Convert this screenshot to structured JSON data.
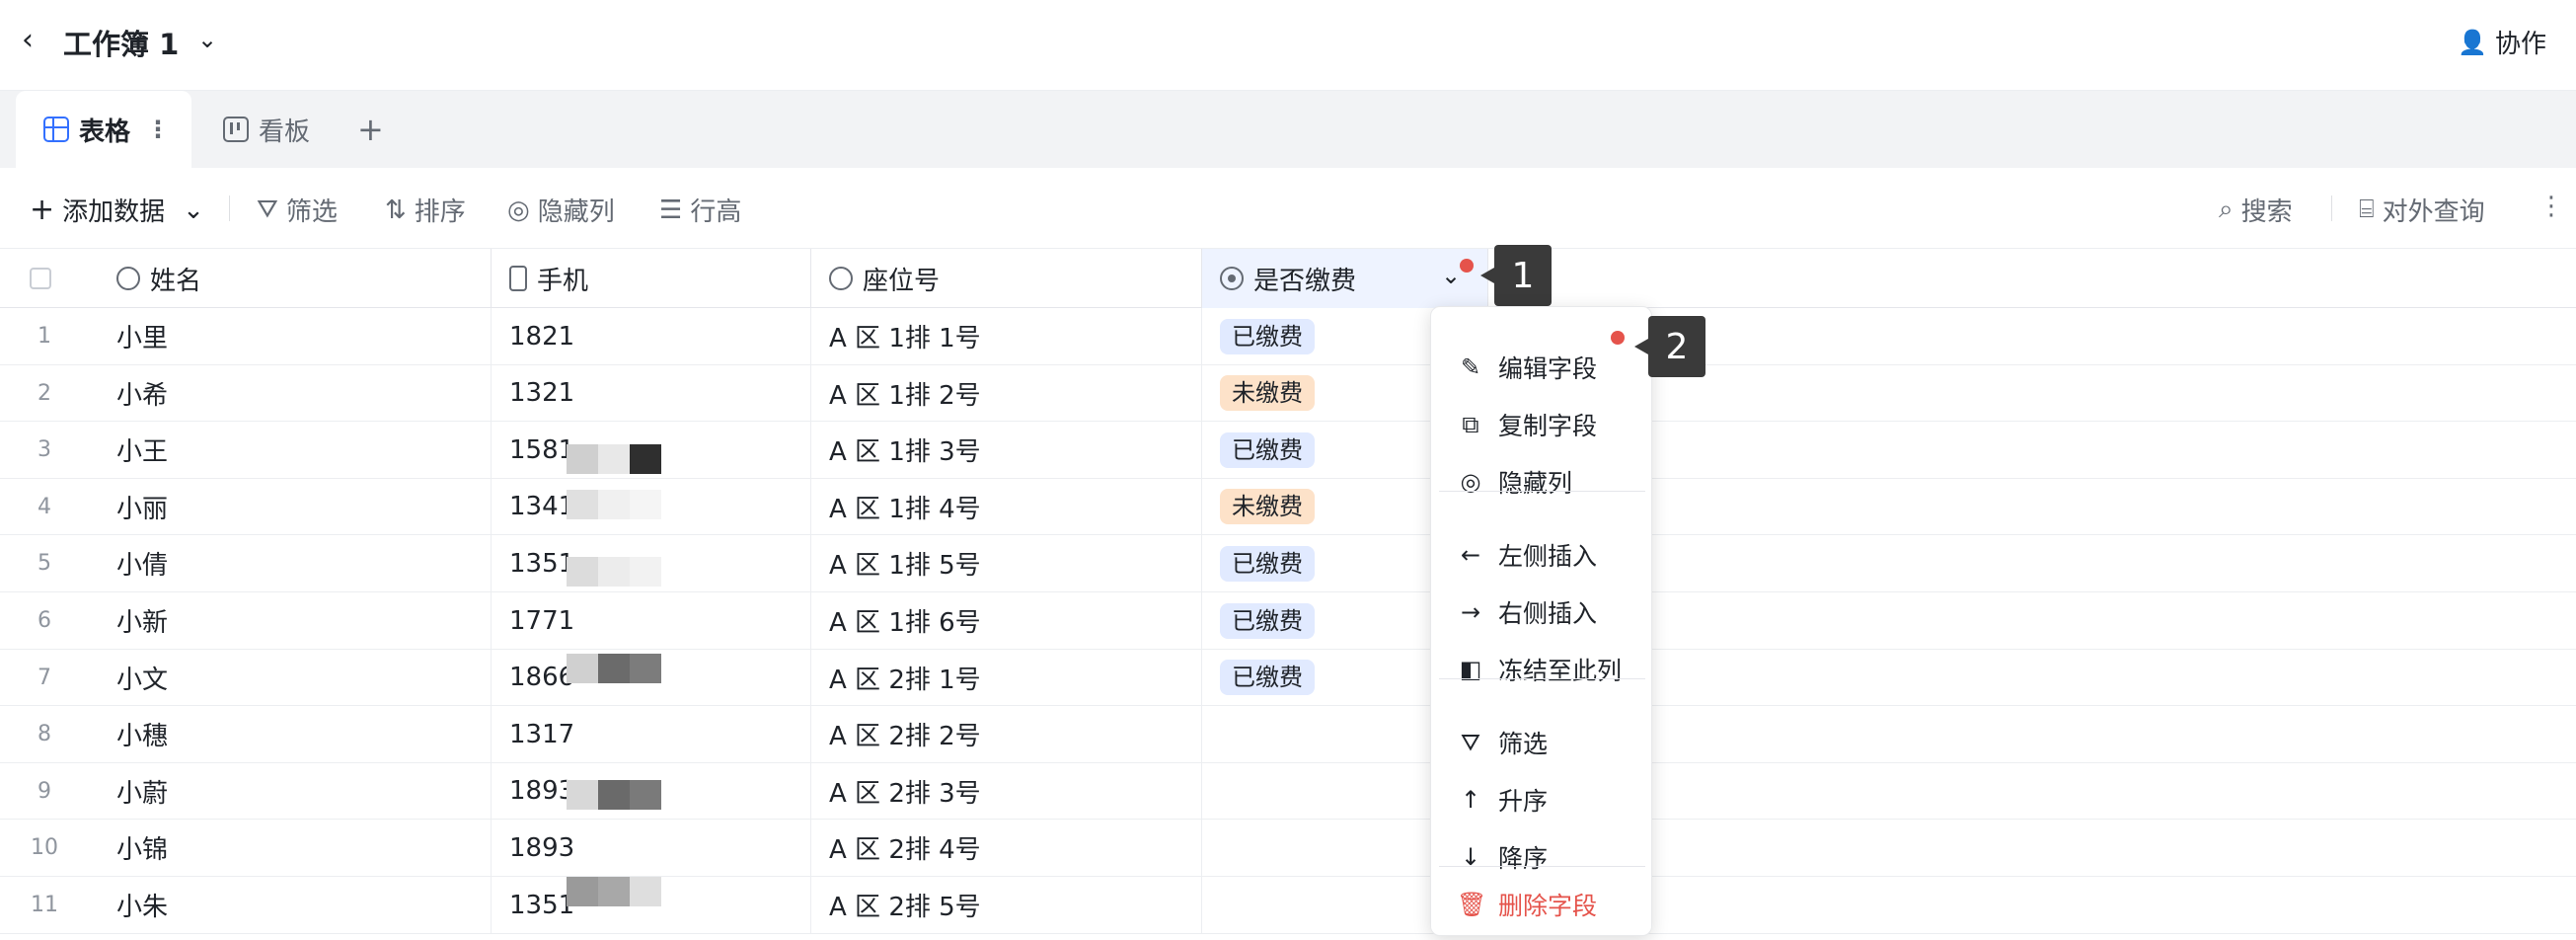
{
  "topbar": {
    "back_icon": "chevron-left-icon",
    "title": "工作簿 1",
    "title_dropdown_icon": "chevron-down-icon",
    "collab_label": "协作",
    "collab_icon": "user-icon"
  },
  "tabs": [
    {
      "label": "表格",
      "icon": "table-icon",
      "active": true
    },
    {
      "label": "看板",
      "icon": "kanban-icon",
      "active": false
    }
  ],
  "tab_more": "⋮",
  "tab_add": "+",
  "toolbar": {
    "add_data": "添加数据",
    "filter": "筛选",
    "sort": "排序",
    "hide_columns": "隐藏列",
    "row_height": "行高",
    "search": "搜索",
    "external_query": "对外查询",
    "more": "⋮"
  },
  "columns": {
    "name": "姓名",
    "phone": "手机",
    "seat": "座位号",
    "paid": "是否缴费"
  },
  "rows": [
    {
      "num": "1",
      "name": "小里",
      "phone": "1821",
      "seat": "A 区 1排 1号",
      "paid": "已缴费",
      "status": "paid"
    },
    {
      "num": "2",
      "name": "小希",
      "phone": "1321",
      "seat": "A 区 1排 2号",
      "paid": "未缴费",
      "status": "unpaid"
    },
    {
      "num": "3",
      "name": "小王",
      "phone": "1581",
      "seat": "A 区 1排 3号",
      "paid": "已缴费",
      "status": "paid"
    },
    {
      "num": "4",
      "name": "小丽",
      "phone": "1341",
      "seat": "A 区 1排 4号",
      "paid": "未缴费",
      "status": "unpaid"
    },
    {
      "num": "5",
      "name": "小倩",
      "phone": "1351",
      "seat": "A 区 1排 5号",
      "paid": "已缴费",
      "status": "paid"
    },
    {
      "num": "6",
      "name": "小新",
      "phone": "1771",
      "seat": "A 区 1排 6号",
      "paid": "已缴费",
      "status": "paid"
    },
    {
      "num": "7",
      "name": "小文",
      "phone": "1866",
      "seat": "A 区 2排 1号",
      "paid": "已缴费",
      "status": "paid"
    },
    {
      "num": "8",
      "name": "小穗",
      "phone": "1317",
      "seat": "A 区 2排 2号",
      "paid": "",
      "status": "none"
    },
    {
      "num": "9",
      "name": "小蔚",
      "phone": "1893",
      "seat": "A 区 2排 3号",
      "paid": "",
      "status": "none"
    },
    {
      "num": "10",
      "name": "小锦",
      "phone": "1893",
      "seat": "A 区 2排 4号",
      "paid": "",
      "status": "none"
    },
    {
      "num": "11",
      "name": "小朱",
      "phone": "1351",
      "seat": "A 区 2排 5号",
      "paid": "",
      "status": "none"
    }
  ],
  "context_menu": {
    "edit_field": "编辑字段",
    "copy_field": "复制字段",
    "hide_column": "隐藏列",
    "insert_left": "左侧插入",
    "insert_right": "右侧插入",
    "freeze_to_here": "冻结至此列",
    "filter": "筛选",
    "ascending": "升序",
    "descending": "降序",
    "delete_field": "删除字段"
  },
  "markers": {
    "m1": "1",
    "m2": "2"
  },
  "colors": {
    "accent": "#3370ff",
    "paid_tag": "#e1eaff",
    "unpaid_tag": "#fde2c9",
    "danger": "#e5534b",
    "marker": "#3a3a3a"
  }
}
